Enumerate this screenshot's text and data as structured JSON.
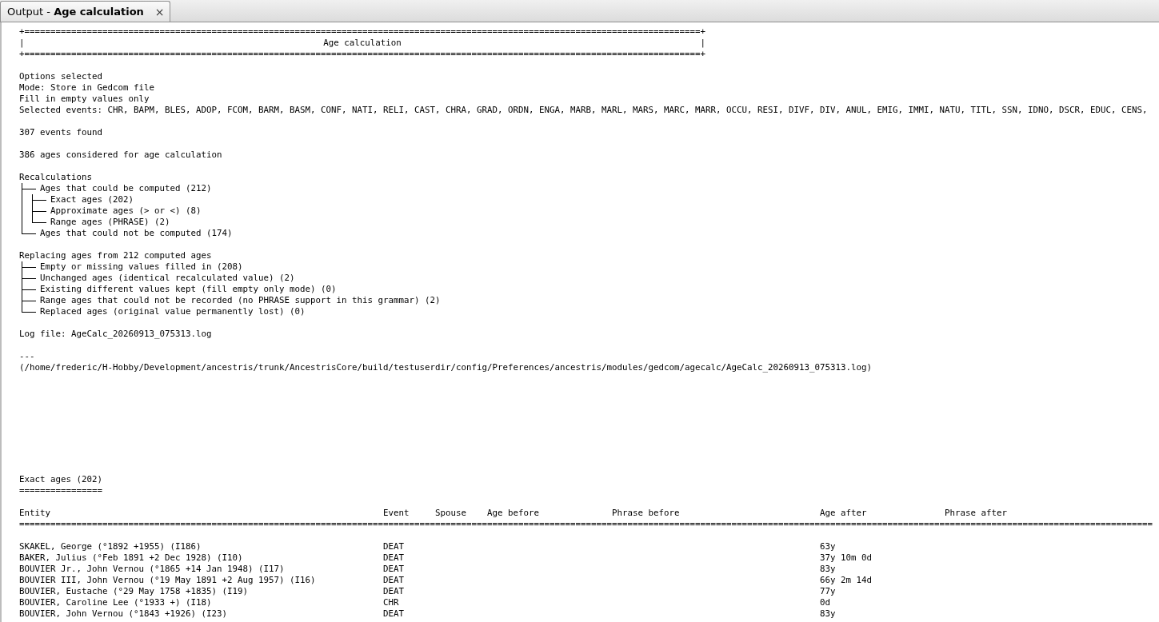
{
  "tab": {
    "title": "Output - **Age calculation**",
    "selected": true,
    "close": "×"
  },
  "banner": {
    "rule_top": "+==================================================================================================================================+",
    "left_edge": "|",
    "title": "Age calculation",
    "right_edge": "|",
    "rule_bottom": "+==================================================================================================================================+"
  },
  "options": {
    "heading": "Options selected",
    "lines": [
      "Mode: Store in Gedcom file",
      "Fill in empty values only",
      "Selected events: CHR, BAPM, BLES, ADOP, FCOM, BARM, BASM, CONF, NATI, RELI, CAST, CHRA, GRAD, ORDN, ENGA, MARB, MARL, MARS, MARC, MARR, OCCU, RESI, DIVF, DIV, ANUL, EMIG, IMMI, NATU, TITL, SSN, IDNO, DSCR, EDUC, CENS,"
    ]
  },
  "events_found": "307 events found",
  "ages_considered": "386 ages considered for age calculation",
  "recalculations": {
    "heading": "Recalculations",
    "items": [
      {
        "label": "Ages that could be computed (212)",
        "children": [
          {
            "label": "Exact ages (202)"
          },
          {
            "label": "Approximate ages (> or <) (8)"
          },
          {
            "label": "Range ages (PHRASE) (2)"
          }
        ]
      },
      {
        "label": "Ages that could not be computed (174)"
      }
    ]
  },
  "replacing": {
    "heading": "Replacing ages from 212 computed ages",
    "items": [
      {
        "label": "Empty or missing values filled in (208)"
      },
      {
        "label": "Unchanged ages (identical recalculated value) (2)"
      },
      {
        "label": "Existing different values kept (fill empty only mode) (0)"
      },
      {
        "label": "Range ages that could not be recorded (no PHRASE support in this grammar) (2)"
      },
      {
        "label": "Replaced ages (original value permanently lost) (0)"
      }
    ]
  },
  "log_file": "Log file: AgeCalc_20260913_075313.log",
  "separator": "---",
  "log_path": "(/home/frederic/H-Hobby/Development/ancestris/trunk/AncestrisCore/build/testuserdir/config/Preferences/ancestris/modules/gedcom/agecalc/AgeCalc_20260913_075313.log)",
  "exact_ages": {
    "heading": "Exact ages (202)",
    "underline": "================",
    "columns": [
      "Entity",
      "Event",
      "Spouse",
      "Age before",
      "Phrase before",
      "Age after",
      "Phrase after"
    ],
    "rule": "==========================================================================================================================================================================================================================",
    "rows": [
      {
        "entity": "SKAKEL, George (°1892 +1955) (I186)",
        "event": "DEAT",
        "age_after": "63y"
      },
      {
        "entity": "BAKER, Julius (°Feb 1891 +2 Dec 1928) (I10)",
        "event": "DEAT",
        "age_after": "37y 10m 0d"
      },
      {
        "entity": "BOUVIER Jr., John Vernou (°1865 +14 Jan 1948) (I17)",
        "event": "DEAT",
        "age_after": "83y"
      },
      {
        "entity": "BOUVIER III, John Vernou (°19 May 1891 +2 Aug 1957) (I16)",
        "event": "DEAT",
        "age_after": "66y 2m 14d"
      },
      {
        "entity": "BOUVIER, Eustache (°29 May 1758 +1835) (I19)",
        "event": "DEAT",
        "age_after": "77y"
      },
      {
        "entity": "BOUVIER, Caroline Lee (°1933 +) (I18)",
        "event": "CHR",
        "age_after": "0d"
      },
      {
        "entity": "BOUVIER, John Vernou (°1843 +1926) (I23)",
        "event": "DEAT",
        "age_after": "83y"
      }
    ]
  }
}
